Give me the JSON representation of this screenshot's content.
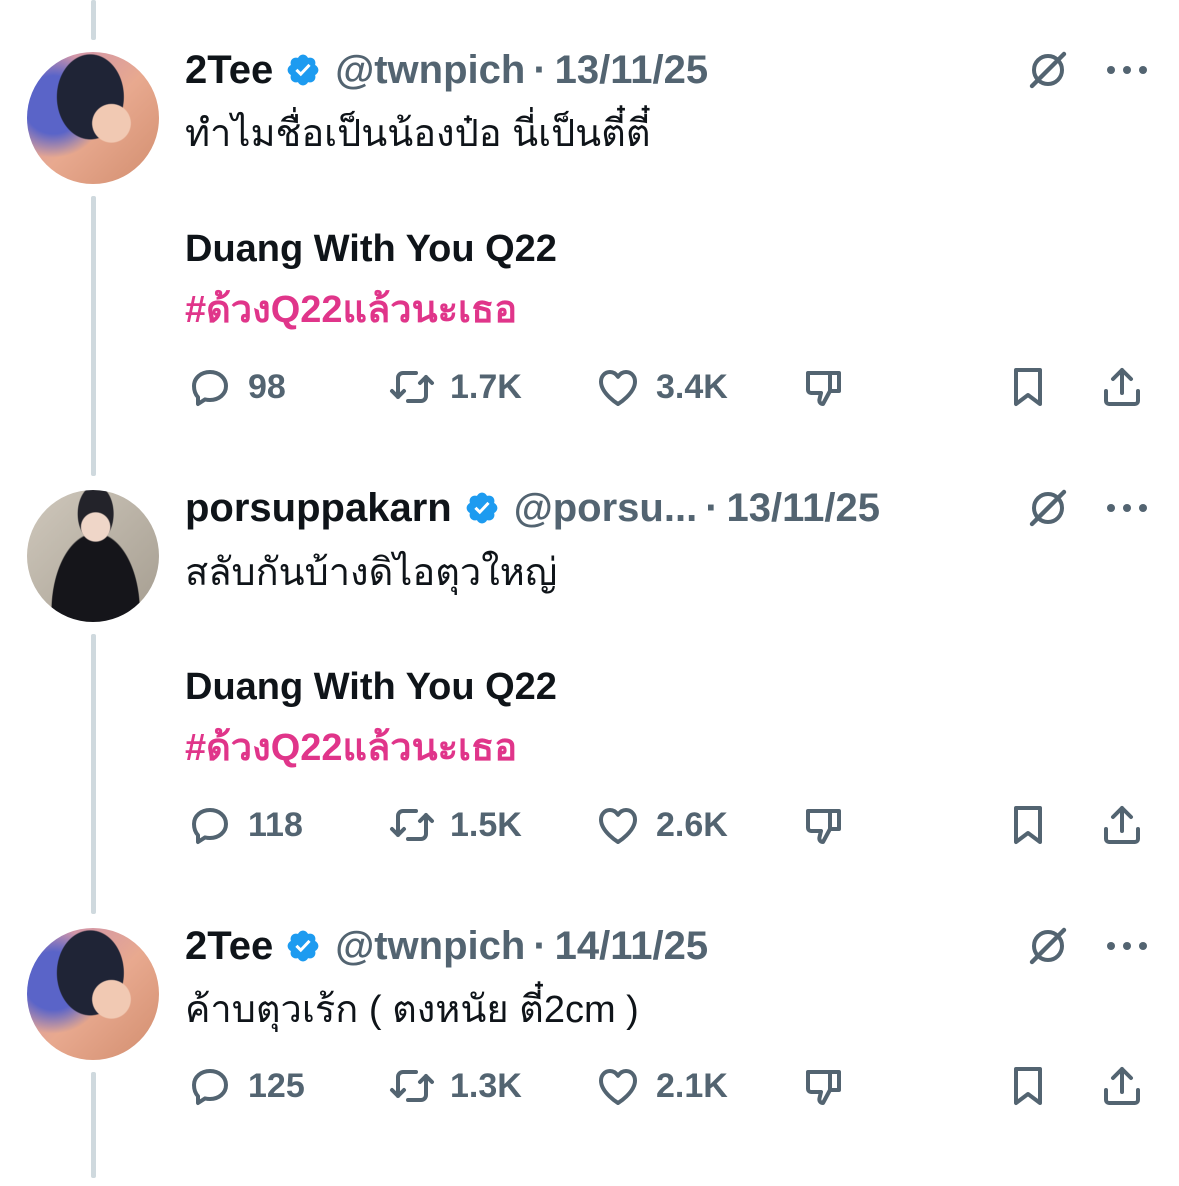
{
  "tweets": [
    {
      "name": "2Tee",
      "handle": "@twnpich",
      "date": "13/11/25",
      "text_line1": "ทำไมชื่อเป็นน้องป๋อ นี่เป็นตี๋ตี๋",
      "title_line": "Duang With You Q22",
      "hashtag": "#ด้วงQ22แล้วนะเธอ",
      "replies": "98",
      "retweets": "1.7K",
      "likes": "3.4K"
    },
    {
      "name": "porsuppakarn",
      "handle": "@porsu...",
      "date": "13/11/25",
      "text_line1": "สลับกันบ้างดิไอตุวใหญ่",
      "title_line": "Duang With You Q22",
      "hashtag": "#ด้วงQ22แล้วนะเธอ",
      "replies": "118",
      "retweets": "1.5K",
      "likes": "2.6K"
    },
    {
      "name": "2Tee",
      "handle": "@twnpich",
      "date": "14/11/25",
      "text_line1": "ค้าบตุวเร้ก ( ตงหนัย ตี๋2cm )",
      "replies": "125",
      "retweets": "1.3K",
      "likes": "2.1K"
    }
  ],
  "header_separator": "·",
  "colors": {
    "hashtag": "#e0358a",
    "secondary_text": "#536471",
    "verified_badge": "#1d9bf0",
    "thread_line": "#cfd9de"
  },
  "icons": [
    "verified-badge-icon",
    "grok-icon",
    "more-icon",
    "reply-icon",
    "retweet-icon",
    "like-icon",
    "dislike-icon",
    "bookmark-icon",
    "share-icon"
  ]
}
